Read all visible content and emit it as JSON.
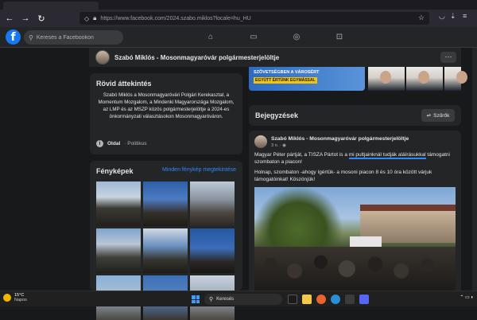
{
  "browser": {
    "url": "https://www.facebook.com/2024.szabo.miklos?locale=hu_HU"
  },
  "fb": {
    "logo": "f",
    "search_placeholder": "Keresés a Facebookon"
  },
  "page": {
    "name": "Szabó Miklós - Mosonmagyaróvár polgármesterjelöltje"
  },
  "intro": {
    "title": "Rövid áttekintés",
    "text": "Szabó Miklós a Mosonmagyaróvári Polgári Kerekasztal, a Momentum Mozgalom, a Mindenki Magyarországa Mozgalom, az LMP és az MSZP közös polgármesterjelöltje a 2024-es önkormányzati választásokon Mosonmagyaróváron.",
    "info_label": "Oldal",
    "info_type": "· Politikus"
  },
  "photos": {
    "title": "Fényképek",
    "link": "Minden fénykép megtekintése"
  },
  "banner": {
    "line1": "SZÖVETSÉGBEN A VÁROSÉRT",
    "line2": "EGYÜTT ÉRTÜNK EGYMÁSSAL"
  },
  "posts": {
    "title": "Bejegyzések",
    "filter": "Szűrők"
  },
  "post": {
    "author": "Szabó Miklós - Mosonmagyaróvár polgármesterjelöltje",
    "date": "3 n. · ",
    "text1_a": "Magyar Péter pártját, a TISZA Pártot is a ",
    "text1_b": "mi pultjainknál tudják aláírásukkal",
    "text1_c": " támogatni szombaton a piacon!",
    "text2": "Holnap, szombaton -ahogy ígértük- a mosoni piacon 8 és 10 óra között várjuk támogatóinkat! Köszönjük!"
  },
  "taskbar": {
    "temp": "15°C",
    "weather": "Napos",
    "search": "Keresés"
  },
  "icons": {
    "back": "arrow-left-icon",
    "forward": "arrow-right-icon",
    "reload": "reload-icon"
  }
}
